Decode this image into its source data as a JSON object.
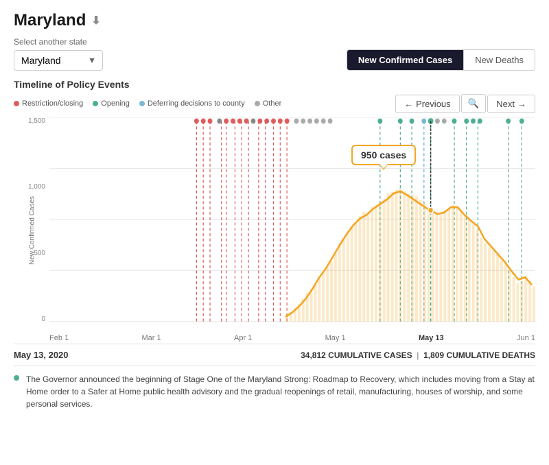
{
  "page": {
    "title": "Maryland",
    "select_label": "Select another state",
    "selected_state": "Maryland",
    "chart_buttons": [
      {
        "label": "New Confirmed Cases",
        "active": true
      },
      {
        "label": "New Deaths",
        "active": false
      }
    ],
    "timeline_title": "Timeline of Policy Events",
    "legend": [
      {
        "label": "Restriction/closing",
        "color": "red"
      },
      {
        "label": "Opening",
        "color": "green"
      },
      {
        "label": "Deferring decisions to county",
        "color": "blue"
      },
      {
        "label": "Other",
        "color": "gray"
      }
    ],
    "nav": {
      "previous": "Previous",
      "next": "Next"
    },
    "y_axis_label": "New Confirmed Cases",
    "y_axis_ticks": [
      "1,500",
      "1,000",
      "500",
      "0"
    ],
    "x_axis_labels": [
      "Feb 1",
      "Mar 1",
      "Apr 1",
      "May 1",
      "May 13",
      "Jun 1"
    ],
    "tooltip": {
      "value": "950 cases",
      "date": "May 13"
    },
    "status_bar": {
      "date": "May 13, 2020",
      "cumulative_cases": "34,812",
      "cumulative_deaths": "1,809",
      "cases_label": "CUMULATIVE CASES",
      "deaths_label": "CUMULATIVE DEATHS"
    },
    "event_description": "The Governor announced the beginning of Stage One of the Maryland Strong: Roadmap to Recovery, which includes moving from a Stay at Home order to a Safer at Home public health advisory and the gradual reopenings of retail, manufacturing, houses of worship, and some personal services."
  }
}
